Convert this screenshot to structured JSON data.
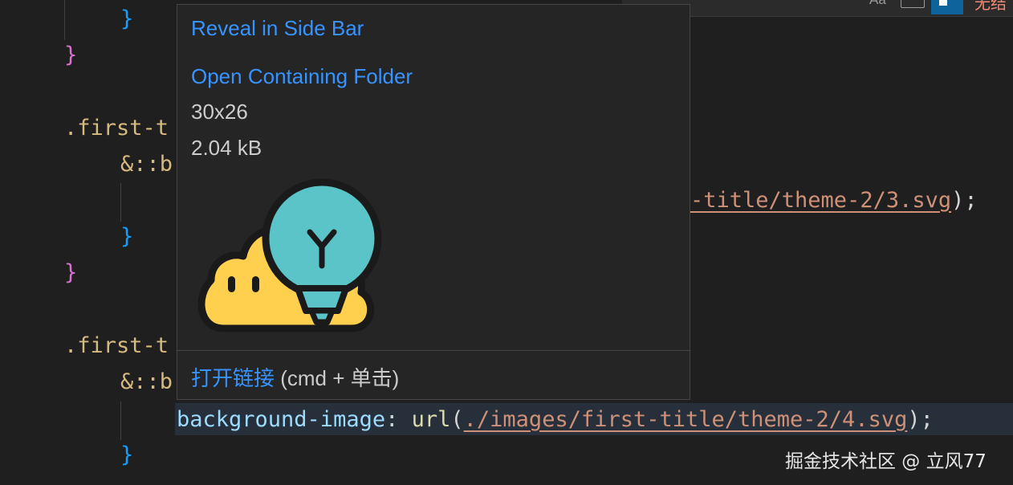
{
  "find_widget": {
    "match_case_label": "Aa",
    "result_text": "无结"
  },
  "editor": {
    "lines": {
      "l1": "}",
      "l2": "}",
      "l3": ".first-t",
      "l4": "&::b",
      "l5_tail": "-title/theme-2/3.svg",
      "l5_end": ");",
      "l6": "}",
      "l7": "}",
      "l8": ".first-t",
      "l9": "&::b",
      "l10_prop": "background-image",
      "l10_colon": ": ",
      "l10_func": "url",
      "l10_paren": "(",
      "l10_url": "./images/first-title/theme-2/4.svg",
      "l10_end": ");",
      "l11": "}"
    }
  },
  "hover": {
    "reveal_link": "Reveal in Side Bar",
    "open_folder_link": "Open Containing Folder",
    "dimensions": "30x26",
    "file_size": "2.04 kB",
    "preview_icon": "lightbulb-cloud-icon",
    "open_link_label": "打开链接",
    "open_link_hint": " (cmd + 单击)"
  },
  "watermark": "掘金技术社区 @ 立风77",
  "colors": {
    "accent_link": "#3794ff",
    "string": "#ce9178",
    "property": "#9cdcfe",
    "selector": "#d7ba7d",
    "function": "#dcdcaa"
  }
}
